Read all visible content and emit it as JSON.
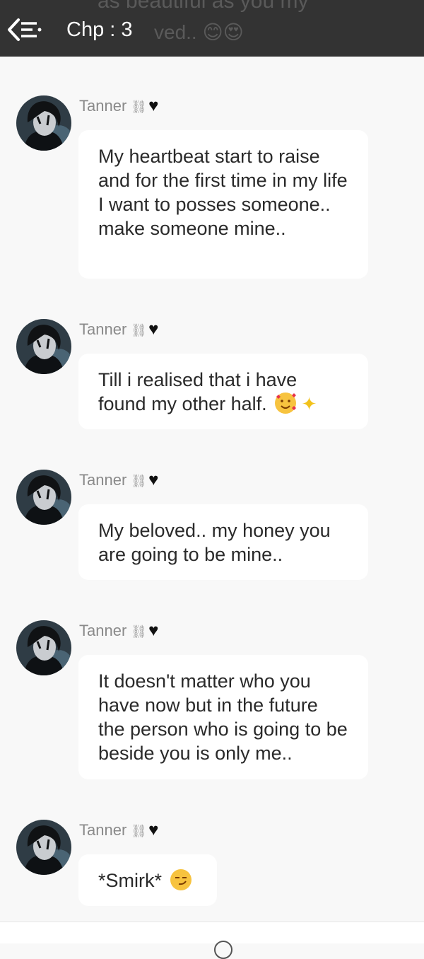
{
  "header": {
    "title": "Chp : 3",
    "ghost_line1": "as beautiful as you my",
    "ghost_line2": "ved.. 😊😍"
  },
  "messages": [
    {
      "sender": "Tanner",
      "text": "My heartbeat start to raise and for the first time in my life I want to posses someone.. make someone mine.."
    },
    {
      "sender": "Tanner",
      "text": "Till i realised that i have found my other half.",
      "emojis": [
        "smiling-face-with-hearts",
        "sparkles"
      ]
    },
    {
      "sender": "Tanner",
      "text": "My beloved.. my honey you are going to be mine.."
    },
    {
      "sender": "Tanner",
      "text": "It doesn't matter who you have now but in the future the person who is going to be beside you is only me.."
    },
    {
      "sender": "Tanner",
      "text": "*Smirk*",
      "emojis": [
        "smirking-face"
      ]
    }
  ],
  "colors": {
    "header_bg": "#333333",
    "page_bg": "#f8f8f8",
    "bubble_bg": "#ffffff"
  }
}
